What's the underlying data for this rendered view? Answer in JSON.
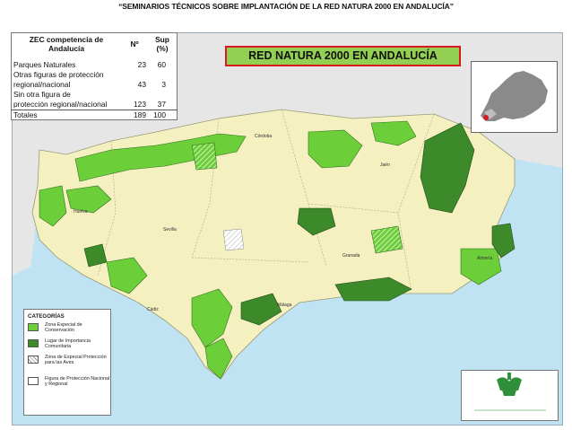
{
  "header": {
    "title": "“SEMINARIOS TÉCNICOS SOBRE IMPLANTACIÓN DE LA RED NATURA 2000 EN ANDALUCÍA”"
  },
  "banner": {
    "title": "RED NATURA 2000 EN ANDALUCÍA",
    "background": "#93cf52",
    "border": "#d8191f"
  },
  "table": {
    "headers": [
      "ZEC competencia de Andalucía",
      "Nº",
      "Sup (%)"
    ],
    "rows": [
      {
        "label": "Parques Naturales",
        "n": "23",
        "sup": "60"
      },
      {
        "label_1": "Otras figuras de protección",
        "label_2": "regional/nacional",
        "n": "43",
        "sup": "3"
      },
      {
        "label_1": "Sin otra figura de",
        "label_2": "protección regional/nacional",
        "n": "123",
        "sup": "37"
      }
    ],
    "total": {
      "label": "Totales",
      "n": "189",
      "sup": "100"
    }
  },
  "map": {
    "cities": {
      "cordoba": "Córdoba",
      "jaen": "Jaén",
      "huelva": "Huelva",
      "sevilla": "Sevilla",
      "granada": "Granada",
      "almeria": "Almería",
      "malaga": "Málaga",
      "cadiz": "Cádiz"
    },
    "colors": {
      "sea": "#bfe3f2",
      "land": "#f4f0c0",
      "outside": "#e6e6e6",
      "zec": "#6ccf3a",
      "lic": "#3c8a2a"
    }
  },
  "legend": {
    "title": "CATEGORÍAS",
    "items": [
      {
        "label": "Zona Especial de Conservación",
        "color": "#6ccf3a"
      },
      {
        "label": "Lugar de Importancia Comunitaria",
        "color": "#3c8a2a"
      },
      {
        "label": "Zona de Especial Protección para las Aves",
        "color": "hatched"
      },
      {
        "label": "Figura de Protección Nacional y Regional",
        "color": "#ffffff"
      }
    ]
  }
}
